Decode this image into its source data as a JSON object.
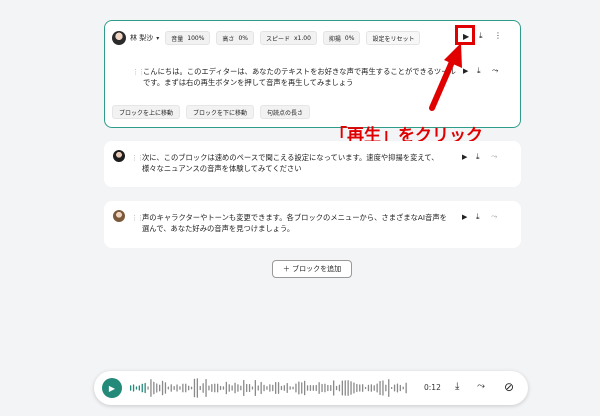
{
  "active_block": {
    "speaker": "林 梨沙",
    "chips": [
      {
        "label": "音量",
        "value": "100%"
      },
      {
        "label": "高さ",
        "value": "0%"
      },
      {
        "label": "スピード",
        "value": "x1.00"
      },
      {
        "label": "抑揚",
        "value": "0%"
      }
    ],
    "reset_label": "設定をリセット",
    "text_line1": "こんにちは。このエディターは、あなたのテキストをお好きな声で再生することができるツール",
    "text_line2": "です。まずは右の再生ボタンを押して音声を再生してみましょう",
    "actions": [
      "ブロックを上に移動",
      "ブロックを下に移動",
      "句読点の長さ"
    ]
  },
  "block2": {
    "text_line1": "次に、このブロックは速めのペースで聞こえる設定になっています。速度や抑揚を変えて、",
    "text_line2": "様々なニュアンスの音声を体験してみてください"
  },
  "block3": {
    "text_line1": "声のキャラクターやトーンも変更できます。各ブロックのメニューから、さまざまなAI音声を",
    "text_line2": "選んで、あなた好みの音声を見つけましょう。"
  },
  "add_block_label": "＋ ブロックを追加",
  "callout_text": "「再生」をクリック",
  "player": {
    "time": "0:12"
  },
  "colors": {
    "accent": "#2f9c8a",
    "play_button": "#238a7a",
    "annotation": "#e00000"
  }
}
